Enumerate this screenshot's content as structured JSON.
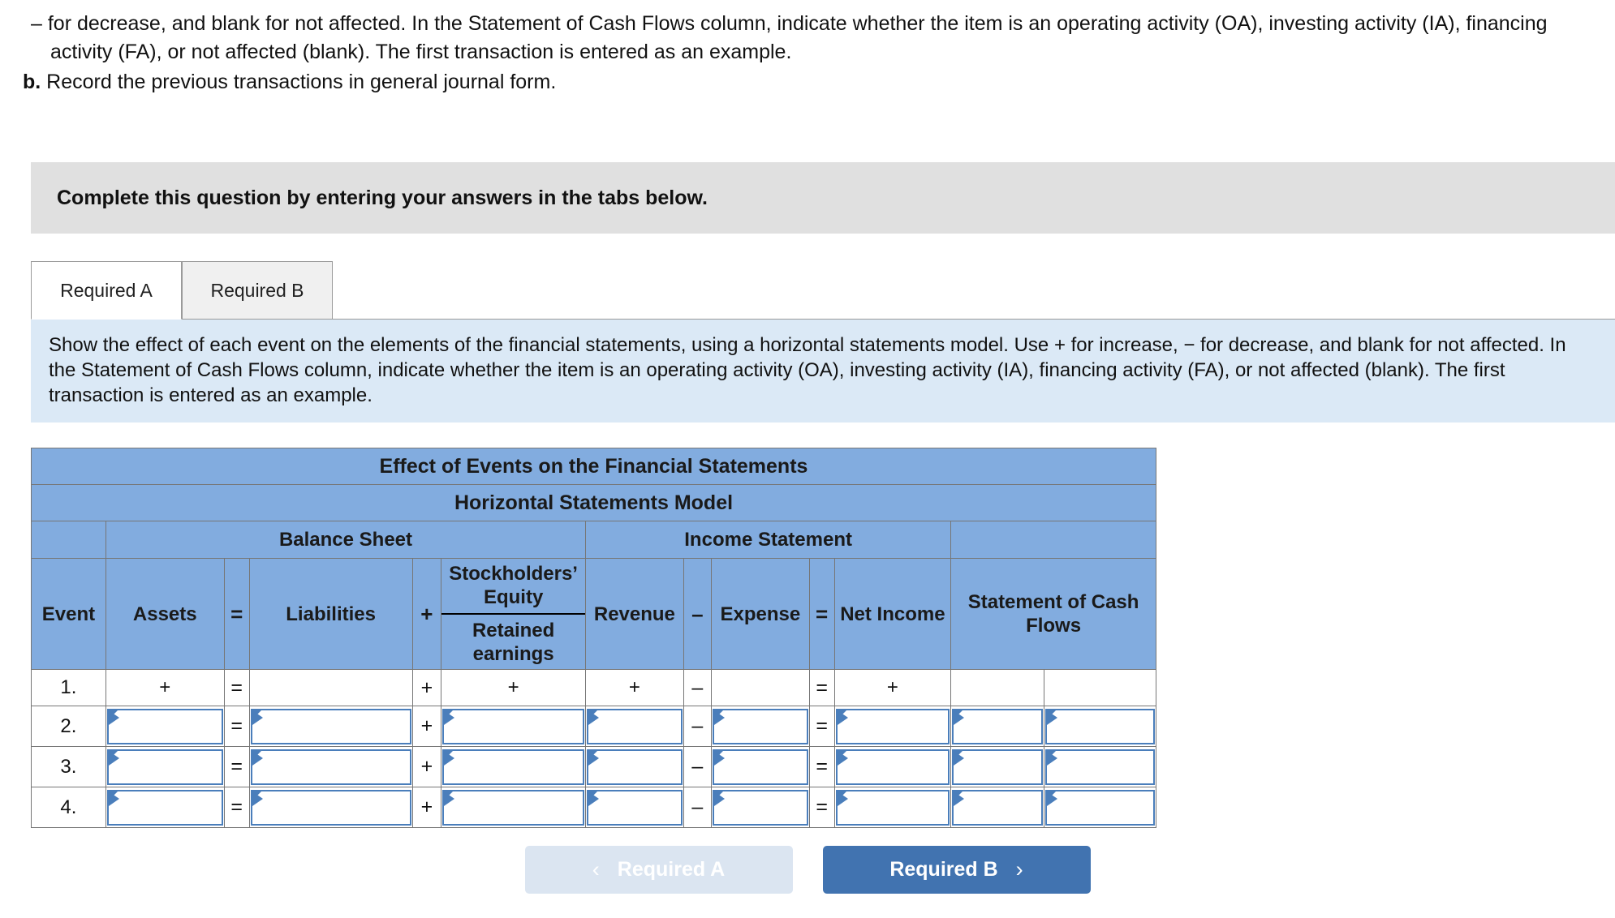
{
  "question": {
    "para_a": "– for decrease, and blank for not affected. In the Statement of Cash Flows column, indicate whether the item is an operating activity (OA), investing activity (IA), financing activity (FA), or not affected (blank). The first transaction is entered as an example.",
    "label_b": "b.",
    "para_b": "Record the previous transactions in general journal form."
  },
  "instruction_band": {
    "text": "Complete this question by entering your answers in the tabs below."
  },
  "tabs": [
    {
      "label": "Required A",
      "state": "active"
    },
    {
      "label": "Required B",
      "state": "inactive"
    }
  ],
  "description": {
    "text": "Show the effect of each event on the elements of the financial statements, using a horizontal statements model. Use + for increase, − for decrease, and blank for not affected. In the Statement of Cash Flows column, indicate whether the item is an operating activity (OA), investing activity (IA), financing activity (FA), or not affected (blank). The first transaction is entered as an example."
  },
  "table": {
    "title": "Effect of Events on the Financial Statements",
    "subtitle": "Horizontal Statements Model",
    "groups": {
      "balance_sheet": "Balance Sheet",
      "income_statement": "Income Statement"
    },
    "columns": {
      "event": "Event",
      "assets": "Assets",
      "eq1": "=",
      "liabilities": "Liabilities",
      "plus1": "+",
      "stockholders_equity": "Stockholders’ Equity",
      "retained_earnings": "Retained earnings",
      "revenue": "Revenue",
      "minus": "–",
      "expense": "Expense",
      "eq2": "=",
      "net_income": "Net Income",
      "cash_flows": "Statement of Cash Flows"
    },
    "rows": [
      {
        "event": "1.",
        "type": "example",
        "assets": "+",
        "eq1": "=",
        "liabilities": "",
        "plus1": "+",
        "equity": "+",
        "revenue": "+",
        "minus": "–",
        "expense": "",
        "eq2": "=",
        "net_income": "+",
        "cf_amount": "",
        "cf_activity": ""
      },
      {
        "event": "2.",
        "type": "input",
        "assets": "",
        "eq1": "=",
        "liabilities": "",
        "plus1": "+",
        "equity": "",
        "revenue": "",
        "minus": "–",
        "expense": "",
        "eq2": "=",
        "net_income": "",
        "cf_amount": "",
        "cf_activity": ""
      },
      {
        "event": "3.",
        "type": "input",
        "assets": "",
        "eq1": "=",
        "liabilities": "",
        "plus1": "+",
        "equity": "",
        "revenue": "",
        "minus": "–",
        "expense": "",
        "eq2": "=",
        "net_income": "",
        "cf_amount": "",
        "cf_activity": ""
      },
      {
        "event": "4.",
        "type": "input",
        "assets": "",
        "eq1": "=",
        "liabilities": "",
        "plus1": "+",
        "equity": "",
        "revenue": "",
        "minus": "–",
        "expense": "",
        "eq2": "=",
        "net_income": "",
        "cf_amount": "",
        "cf_activity": ""
      }
    ]
  },
  "nav": {
    "prev_label": "Required A",
    "prev_icon": "chevron-left-icon",
    "next_label": "Required B",
    "next_icon": "chevron-right-icon"
  },
  "colors": {
    "header_blue": "#82acdf",
    "panel_blue": "#dbe9f6",
    "band_gray": "#e0e0e0",
    "input_border": "#4a7ebb",
    "next_button": "#4173b0",
    "prev_button": "#dbe5f1"
  }
}
